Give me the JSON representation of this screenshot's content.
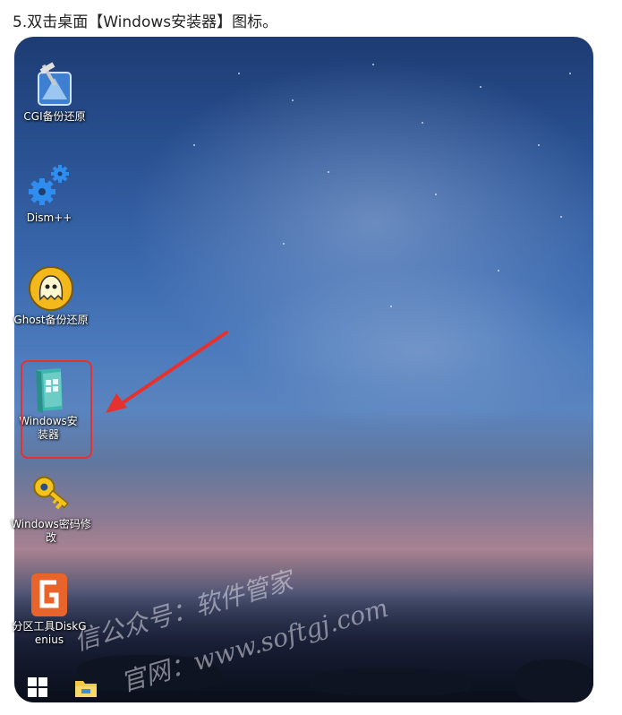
{
  "caption": "5.双击桌面【Windows安装器】图标。",
  "desktop_icons": [
    {
      "label": "CGI备份还原"
    },
    {
      "label": "Dism++"
    },
    {
      "label": "Ghost备份还原"
    },
    {
      "label": "Windows安装器"
    },
    {
      "label": "Windows密码修改"
    },
    {
      "label": "分区工具DiskGenius"
    }
  ],
  "watermark": {
    "line1": "信公众号：软件管家",
    "line2": "官网：www.softgj.com"
  },
  "colors": {
    "highlight": "#e6312f",
    "arrow": "#e6312f"
  }
}
